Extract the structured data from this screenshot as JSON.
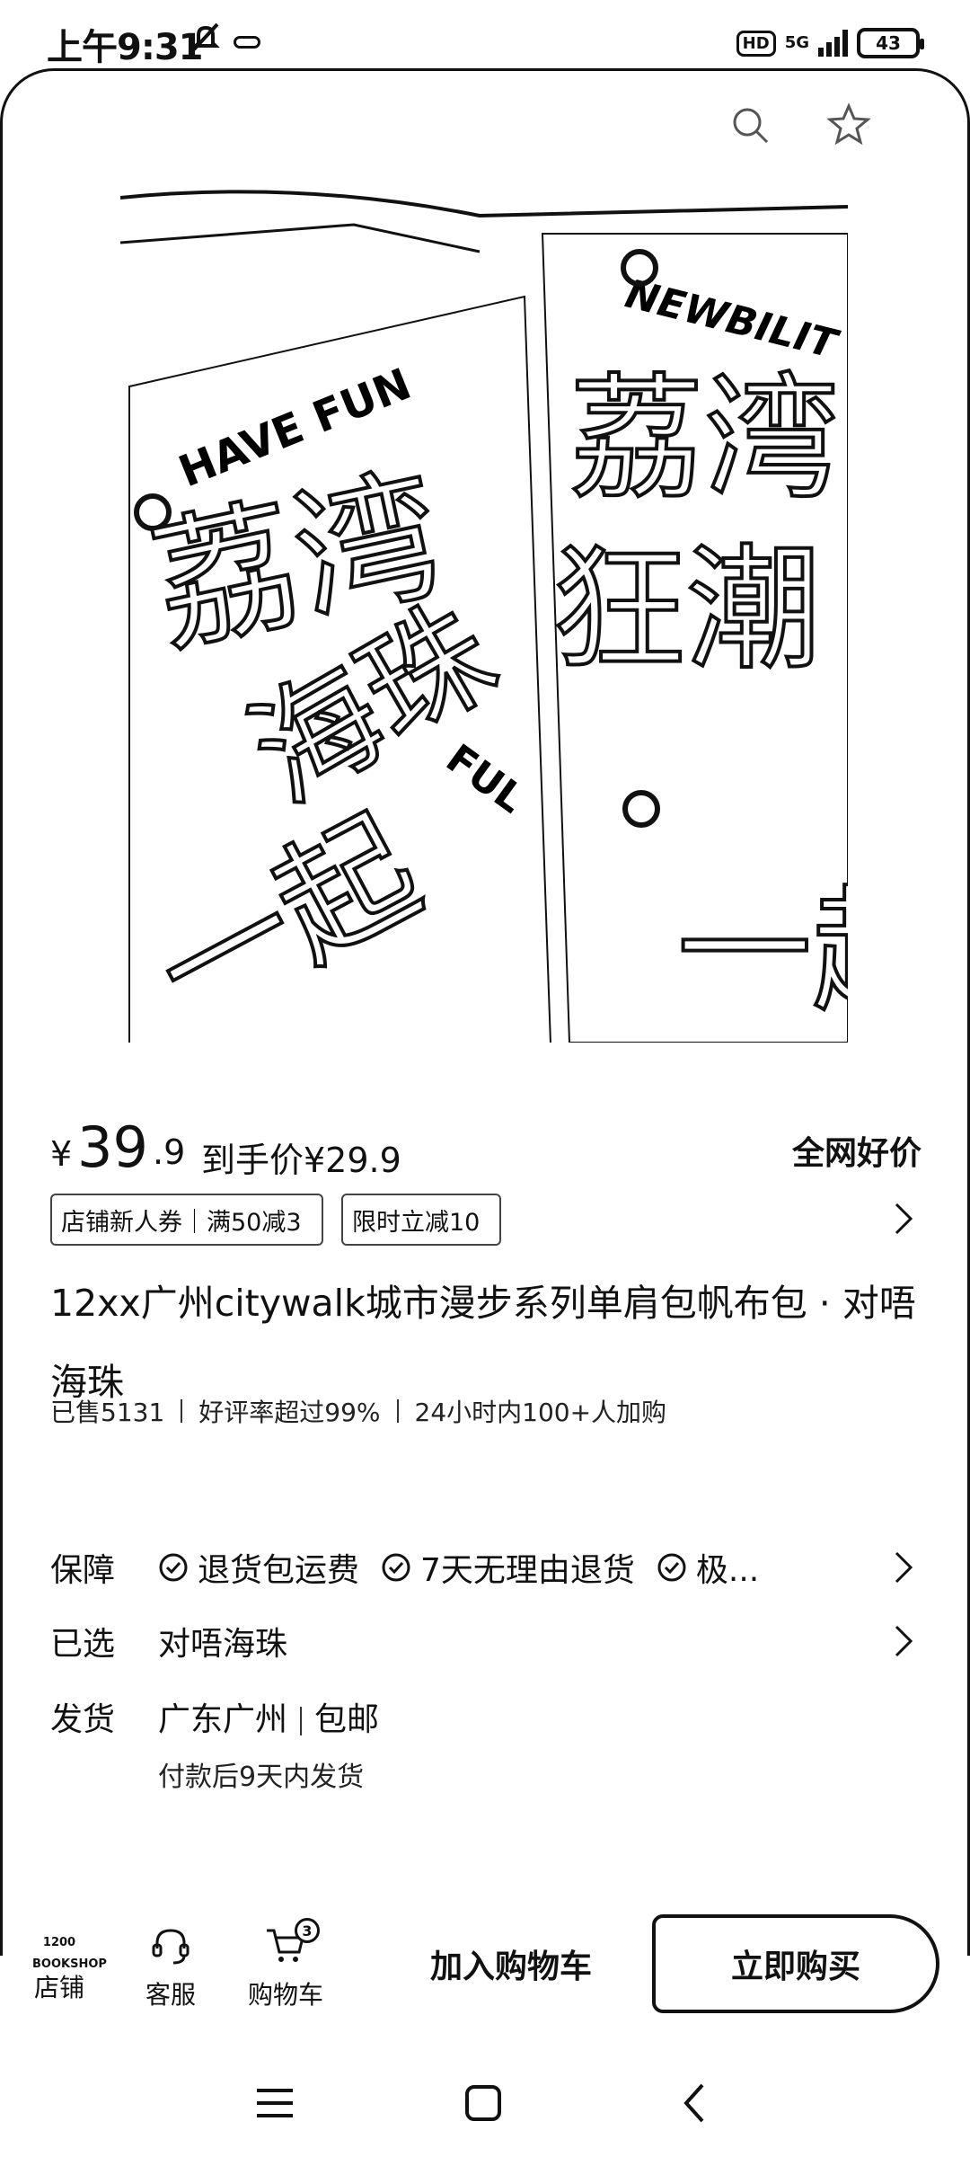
{
  "status_bar": {
    "time": "上午9:31",
    "hd": "HD",
    "network": "5G",
    "battery": "43"
  },
  "hero": {
    "texts": [
      "HAVE FUN",
      "NEWBILIT",
      "FUL",
      "荔湾",
      "狂潮",
      "一起",
      "海珠"
    ]
  },
  "price": {
    "symbol": "¥",
    "main": "39",
    "decimal": ".9",
    "final_label": "到手价¥29.9",
    "best_label": "全网好价"
  },
  "coupons": [
    {
      "label": "店铺新人券｜满50减3"
    },
    {
      "label": "限时立减10"
    }
  ],
  "product": {
    "title": "12xx广州citywalk城市漫步系列单肩包帆布包 · 对唔海珠",
    "sold": "已售5131",
    "rating": "好评率超过99%",
    "carts": "24小时内100+人加购"
  },
  "info": {
    "guarantee_label": "保障",
    "guarantees": [
      "退货包运费",
      "7天无理由退货",
      "极..."
    ],
    "selected_label": "已选",
    "selected_value": "对唔海珠",
    "shipping_label": "发货",
    "ship_from": "广东广州",
    "ship_free": "包邮",
    "ship_note": "付款后9天内发货"
  },
  "actions": {
    "shop_logo": "1200 BOOKSHOP",
    "shop": "店铺",
    "service": "客服",
    "cart": "购物车",
    "cart_count": "3",
    "add_to_cart": "加入购物车",
    "buy_now": "立即购买"
  }
}
